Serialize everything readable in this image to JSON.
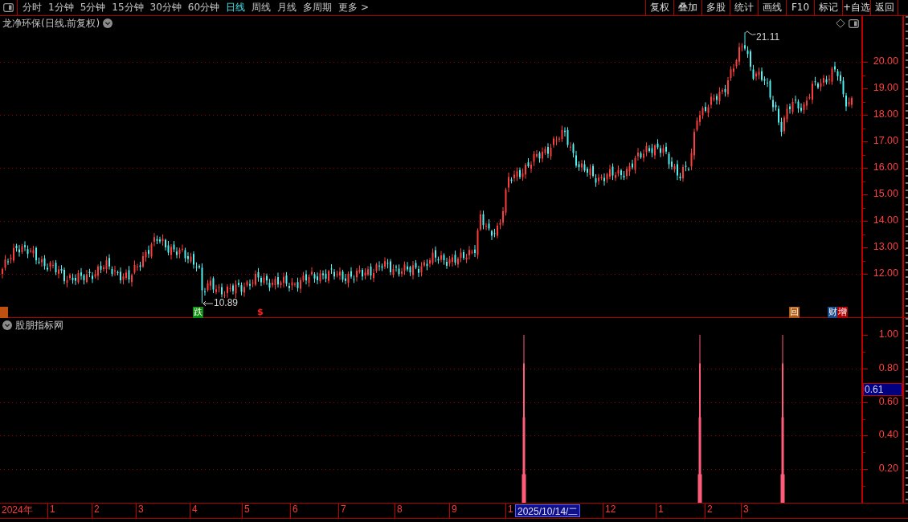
{
  "toolbar": {
    "periods": [
      {
        "label": "分时",
        "selected": false
      },
      {
        "label": "1分钟",
        "selected": false
      },
      {
        "label": "5分钟",
        "selected": false
      },
      {
        "label": "15分钟",
        "selected": false
      },
      {
        "label": "30分钟",
        "selected": false
      },
      {
        "label": "60分钟",
        "selected": false
      },
      {
        "label": "日线",
        "selected": true
      },
      {
        "label": "周线",
        "selected": false
      },
      {
        "label": "月线",
        "selected": false
      },
      {
        "label": "多周期",
        "selected": false
      },
      {
        "label": "更多 >",
        "selected": false
      }
    ],
    "actions": [
      "复权",
      "叠加",
      "多股",
      "统计",
      "画线",
      "F10",
      "标记",
      "+自选",
      "返回"
    ]
  },
  "main_chart": {
    "title": "龙净环保(日线.前复权)",
    "price_axis": [
      "20.00",
      "19.00",
      "18.00",
      "17.00",
      "16.00",
      "15.00",
      "14.00",
      "13.00",
      "12.00"
    ],
    "high_label": "21.11",
    "low_label": "10.89",
    "markers": [
      {
        "text": "跌",
        "kind": "tag",
        "color": "#0a8a0a"
      },
      {
        "text": "$",
        "kind": "glyph",
        "color": "#ff2020"
      },
      {
        "text": "回",
        "kind": "tag",
        "color": "#b05a10"
      },
      {
        "text": "财",
        "kind": "tag",
        "color": "#1a4a8a"
      },
      {
        "text": "增",
        "kind": "tag",
        "color": "#b00000"
      }
    ]
  },
  "indicator": {
    "title": "股朋指标网",
    "value_axis": [
      "1.00",
      "0.80",
      "0.60",
      "0.40",
      "0.20"
    ],
    "crosshair_value": "0.61"
  },
  "date_axis": {
    "labels": [
      "2024年",
      "1",
      "2",
      "3",
      "4",
      "5",
      "6",
      "7",
      "8",
      "9",
      "1",
      "12",
      "1",
      "2",
      "3"
    ],
    "cursor_date": "2025/10/14/二"
  }
}
